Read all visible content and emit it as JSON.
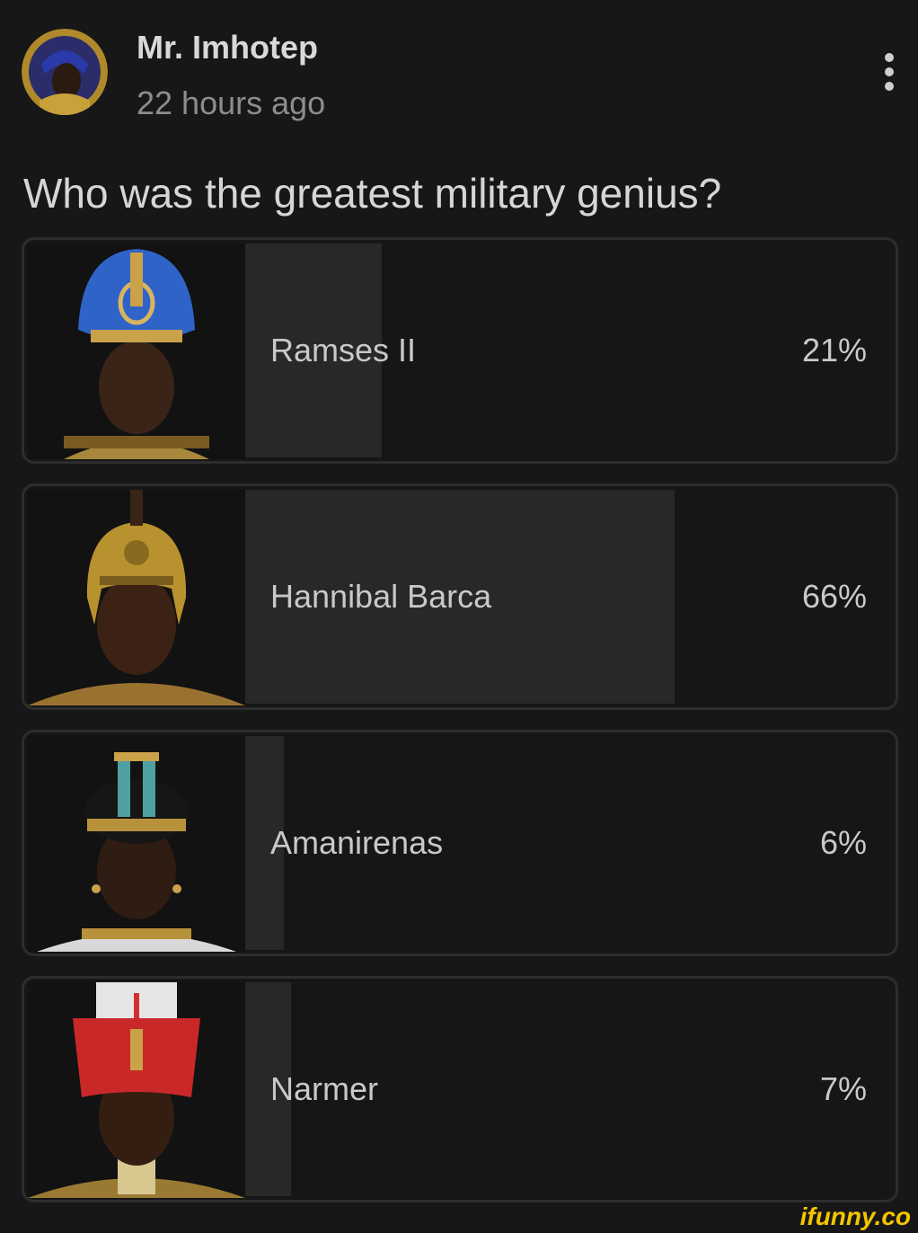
{
  "post": {
    "author": "Mr. Imhotep",
    "timestamp": "22 hours ago",
    "question": "Who was the greatest military genius?"
  },
  "poll": {
    "options": [
      {
        "label": "Ramses II",
        "percent_text": "21%",
        "fill_percent": 21,
        "headdress": "blue-crown"
      },
      {
        "label": "Hannibal Barca",
        "percent_text": "66%",
        "fill_percent": 66,
        "headdress": "gold-helmet"
      },
      {
        "label": "Amanirenas",
        "percent_text": "6%",
        "fill_percent": 6,
        "headdress": "crown-band"
      },
      {
        "label": "Narmer",
        "percent_text": "7%",
        "fill_percent": 7,
        "headdress": "red-crown"
      }
    ]
  },
  "watermark": "ifunny.co",
  "colors": {
    "background": "#171717",
    "bar_fill": "#282828",
    "brand": "#f4c500"
  }
}
